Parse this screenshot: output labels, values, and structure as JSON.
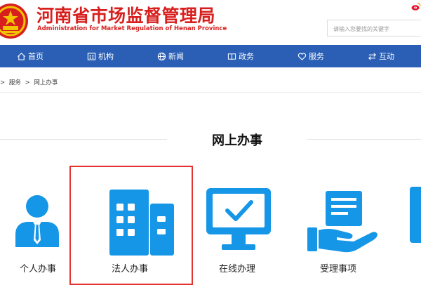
{
  "header": {
    "title_cn": "河南省市场监督管理局",
    "title_en": "Administration for Market Regulation of Henan Province",
    "search_placeholder": "请输入您要找的关键字"
  },
  "nav": {
    "items": [
      {
        "label": "首页",
        "icon": "home-icon"
      },
      {
        "label": "机构",
        "icon": "building-icon"
      },
      {
        "label": "新闻",
        "icon": "globe-icon"
      },
      {
        "label": "政务",
        "icon": "book-icon"
      },
      {
        "label": "服务",
        "icon": "heart-icon"
      },
      {
        "label": "互动",
        "icon": "exchange-icon"
      }
    ]
  },
  "breadcrumb": {
    "items": [
      ">",
      "服务",
      ">",
      "网上办事"
    ]
  },
  "section": {
    "title": "网上办事"
  },
  "services": [
    {
      "label": "个人办事",
      "icon": "person-icon"
    },
    {
      "label": "法人办事",
      "icon": "buildings-icon",
      "selected": true
    },
    {
      "label": "在线办理",
      "icon": "monitor-check-icon"
    },
    {
      "label": "受理事项",
      "icon": "hand-document-icon"
    }
  ],
  "colors": {
    "brand_red": "#d7201e",
    "nav_blue": "#2a5fb5",
    "icon_blue": "#1596e6",
    "highlight_red": "#e3342f"
  }
}
